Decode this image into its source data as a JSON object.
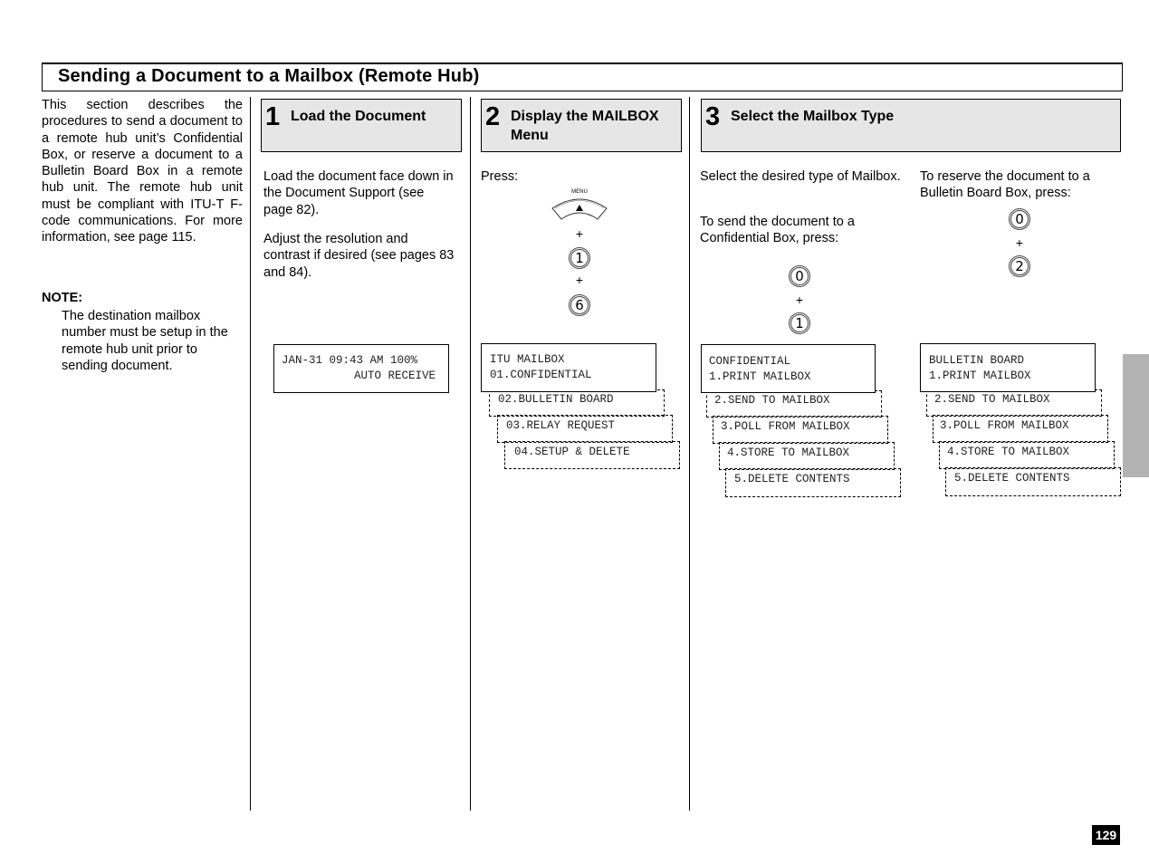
{
  "title": "Sending a Document to a Mailbox (Remote Hub)",
  "intro": {
    "text": "This section describes the procedures to send a document to a remote hub unit’s Confidential Box, or reserve a document to a Bulletin Board Box in a remote hub unit. The remote hub unit must be compliant with ITU-T F-code communications. For more information, see page 115.",
    "note_label": "NOTE:",
    "note_text": "The destination mailbox number must be setup in the remote hub unit prior to sending document."
  },
  "steps": [
    {
      "number": "1",
      "title": "Load the Document",
      "paragraphs": [
        "Load the document face down in the Document Support (see page 82).",
        "Adjust the resolution and contrast if desired (see pages 83 and 84)."
      ],
      "display": {
        "line1": "JAN-31 09:43 AM 100%",
        "line2": "AUTO RECEIVE"
      }
    },
    {
      "number": "2",
      "title": "Display the MAILBOX Menu",
      "instruction": "Press:",
      "keys": {
        "menu_label": "MENU",
        "plus": "+",
        "key1": "1",
        "key2": "6"
      },
      "display": {
        "line1": "ITU MAILBOX",
        "line2": "01.CONFIDENTIAL",
        "menu_items": [
          "02.BULLETIN BOARD",
          "03.RELAY REQUEST",
          "04.SETUP & DELETE"
        ]
      }
    },
    {
      "number": "3",
      "title": "Select the Mailbox Type",
      "left": {
        "intro": "Select the desired type of Mailbox.",
        "instruction": "To send the document to a Confidential Box, press:",
        "keys": [
          "0",
          "1"
        ],
        "display": {
          "line1": "CONFIDENTIAL",
          "line2": "1.PRINT MAILBOX",
          "menu_items": [
            "2.SEND TO MAILBOX",
            "3.POLL FROM MAILBOX",
            "4.STORE TO MAILBOX",
            "5.DELETE CONTENTS"
          ]
        }
      },
      "right": {
        "instruction": "To reserve the document to a Bulletin Board Box, press:",
        "keys": [
          "0",
          "2"
        ],
        "display": {
          "line1": "BULLETIN BOARD",
          "line2": "1.PRINT MAILBOX",
          "menu_items": [
            "2.SEND TO MAILBOX",
            "3.POLL FROM MAILBOX",
            "4.STORE TO MAILBOX",
            "5.DELETE CONTENTS"
          ]
        }
      }
    }
  ],
  "plus_sign": "+",
  "page_number": "129"
}
